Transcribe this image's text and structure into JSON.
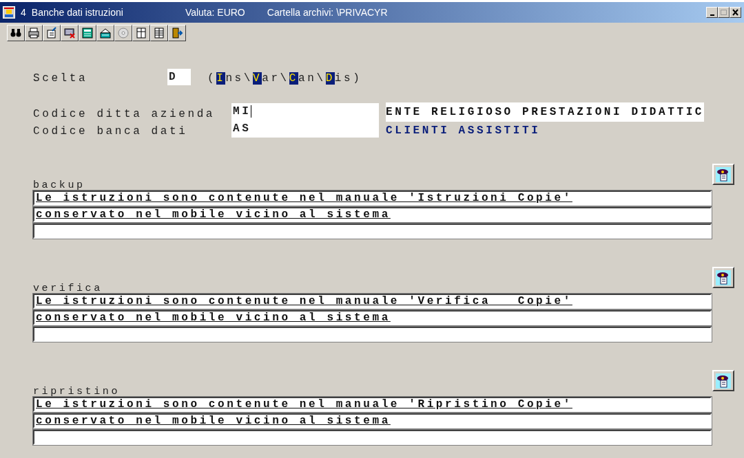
{
  "window": {
    "number": "4",
    "title": "Banche dati istruzioni",
    "currency": "Valuta: EURO",
    "folder": "Cartella archivi: \\PRIVACYR"
  },
  "toolbar": [
    {
      "kind": "binoculars"
    },
    {
      "kind": "printer"
    },
    {
      "kind": "edit"
    },
    {
      "kind": "delete"
    },
    {
      "kind": "calculator"
    },
    {
      "kind": "inbox"
    },
    {
      "kind": "disc"
    },
    {
      "kind": "columns"
    },
    {
      "kind": "sheet"
    },
    {
      "kind": "exit"
    }
  ],
  "choice": {
    "label": "Scelta",
    "value": "D",
    "open": "(",
    "options": [
      {
        "hotkey": "I",
        "rest": "ns",
        "separator": "\\"
      },
      {
        "hotkey": "V",
        "rest": "ar",
        "separator": "\\"
      },
      {
        "hotkey": "C",
        "rest": "an",
        "separator": "\\"
      },
      {
        "hotkey": "D",
        "rest": "is"
      }
    ],
    "close": ")"
  },
  "codes": [
    {
      "label": "Codice ditta azienda",
      "value": "MI",
      "focused": true,
      "description": "ENTE RELIGIOSO PRESTAZIONI DIDATTIC",
      "kind": "boxed"
    },
    {
      "label": "Codice banca dati",
      "value": "AS",
      "focused": false,
      "description": "CLIENTI ASSISTITI",
      "kind": "plain"
    }
  ],
  "sections": [
    {
      "label": "backup",
      "lines": [
        "Le istruzioni sono contenute nel manuale 'Istruzioni Copie'",
        "conservato nel mobile vicino al sistema"
      ],
      "blank_line": true
    },
    {
      "label": "verifica",
      "lines": [
        "Le istruzioni sono contenute nel manuale 'Verifica   Copie'",
        "conservato nel mobile vicino al sistema"
      ],
      "blank_line": true
    },
    {
      "label": "ripristino",
      "lines": [
        "Le istruzioni sono contenute nel manuale 'Ripristino Copie'",
        "conservato nel mobile vicino al sistema"
      ],
      "blank_line": true
    }
  ]
}
